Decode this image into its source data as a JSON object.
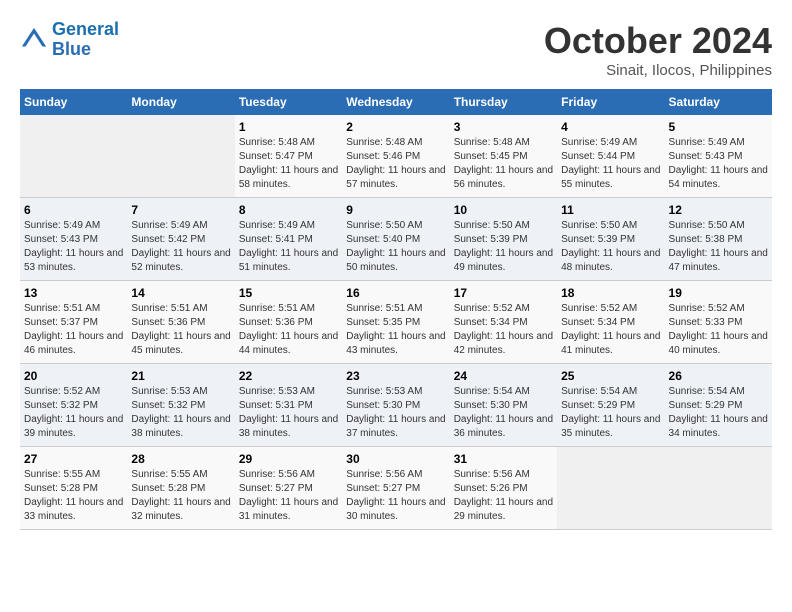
{
  "header": {
    "logo_line1": "General",
    "logo_line2": "Blue",
    "month": "October 2024",
    "location": "Sinait, Ilocos, Philippines"
  },
  "weekdays": [
    "Sunday",
    "Monday",
    "Tuesday",
    "Wednesday",
    "Thursday",
    "Friday",
    "Saturday"
  ],
  "weeks": [
    [
      {
        "day": "",
        "info": ""
      },
      {
        "day": "",
        "info": ""
      },
      {
        "day": "1",
        "info": "Sunrise: 5:48 AM\nSunset: 5:47 PM\nDaylight: 11 hours and 58 minutes."
      },
      {
        "day": "2",
        "info": "Sunrise: 5:48 AM\nSunset: 5:46 PM\nDaylight: 11 hours and 57 minutes."
      },
      {
        "day": "3",
        "info": "Sunrise: 5:48 AM\nSunset: 5:45 PM\nDaylight: 11 hours and 56 minutes."
      },
      {
        "day": "4",
        "info": "Sunrise: 5:49 AM\nSunset: 5:44 PM\nDaylight: 11 hours and 55 minutes."
      },
      {
        "day": "5",
        "info": "Sunrise: 5:49 AM\nSunset: 5:43 PM\nDaylight: 11 hours and 54 minutes."
      }
    ],
    [
      {
        "day": "6",
        "info": "Sunrise: 5:49 AM\nSunset: 5:43 PM\nDaylight: 11 hours and 53 minutes."
      },
      {
        "day": "7",
        "info": "Sunrise: 5:49 AM\nSunset: 5:42 PM\nDaylight: 11 hours and 52 minutes."
      },
      {
        "day": "8",
        "info": "Sunrise: 5:49 AM\nSunset: 5:41 PM\nDaylight: 11 hours and 51 minutes."
      },
      {
        "day": "9",
        "info": "Sunrise: 5:50 AM\nSunset: 5:40 PM\nDaylight: 11 hours and 50 minutes."
      },
      {
        "day": "10",
        "info": "Sunrise: 5:50 AM\nSunset: 5:39 PM\nDaylight: 11 hours and 49 minutes."
      },
      {
        "day": "11",
        "info": "Sunrise: 5:50 AM\nSunset: 5:39 PM\nDaylight: 11 hours and 48 minutes."
      },
      {
        "day": "12",
        "info": "Sunrise: 5:50 AM\nSunset: 5:38 PM\nDaylight: 11 hours and 47 minutes."
      }
    ],
    [
      {
        "day": "13",
        "info": "Sunrise: 5:51 AM\nSunset: 5:37 PM\nDaylight: 11 hours and 46 minutes."
      },
      {
        "day": "14",
        "info": "Sunrise: 5:51 AM\nSunset: 5:36 PM\nDaylight: 11 hours and 45 minutes."
      },
      {
        "day": "15",
        "info": "Sunrise: 5:51 AM\nSunset: 5:36 PM\nDaylight: 11 hours and 44 minutes."
      },
      {
        "day": "16",
        "info": "Sunrise: 5:51 AM\nSunset: 5:35 PM\nDaylight: 11 hours and 43 minutes."
      },
      {
        "day": "17",
        "info": "Sunrise: 5:52 AM\nSunset: 5:34 PM\nDaylight: 11 hours and 42 minutes."
      },
      {
        "day": "18",
        "info": "Sunrise: 5:52 AM\nSunset: 5:34 PM\nDaylight: 11 hours and 41 minutes."
      },
      {
        "day": "19",
        "info": "Sunrise: 5:52 AM\nSunset: 5:33 PM\nDaylight: 11 hours and 40 minutes."
      }
    ],
    [
      {
        "day": "20",
        "info": "Sunrise: 5:52 AM\nSunset: 5:32 PM\nDaylight: 11 hours and 39 minutes."
      },
      {
        "day": "21",
        "info": "Sunrise: 5:53 AM\nSunset: 5:32 PM\nDaylight: 11 hours and 38 minutes."
      },
      {
        "day": "22",
        "info": "Sunrise: 5:53 AM\nSunset: 5:31 PM\nDaylight: 11 hours and 38 minutes."
      },
      {
        "day": "23",
        "info": "Sunrise: 5:53 AM\nSunset: 5:30 PM\nDaylight: 11 hours and 37 minutes."
      },
      {
        "day": "24",
        "info": "Sunrise: 5:54 AM\nSunset: 5:30 PM\nDaylight: 11 hours and 36 minutes."
      },
      {
        "day": "25",
        "info": "Sunrise: 5:54 AM\nSunset: 5:29 PM\nDaylight: 11 hours and 35 minutes."
      },
      {
        "day": "26",
        "info": "Sunrise: 5:54 AM\nSunset: 5:29 PM\nDaylight: 11 hours and 34 minutes."
      }
    ],
    [
      {
        "day": "27",
        "info": "Sunrise: 5:55 AM\nSunset: 5:28 PM\nDaylight: 11 hours and 33 minutes."
      },
      {
        "day": "28",
        "info": "Sunrise: 5:55 AM\nSunset: 5:28 PM\nDaylight: 11 hours and 32 minutes."
      },
      {
        "day": "29",
        "info": "Sunrise: 5:56 AM\nSunset: 5:27 PM\nDaylight: 11 hours and 31 minutes."
      },
      {
        "day": "30",
        "info": "Sunrise: 5:56 AM\nSunset: 5:27 PM\nDaylight: 11 hours and 30 minutes."
      },
      {
        "day": "31",
        "info": "Sunrise: 5:56 AM\nSunset: 5:26 PM\nDaylight: 11 hours and 29 minutes."
      },
      {
        "day": "",
        "info": ""
      },
      {
        "day": "",
        "info": ""
      }
    ]
  ]
}
